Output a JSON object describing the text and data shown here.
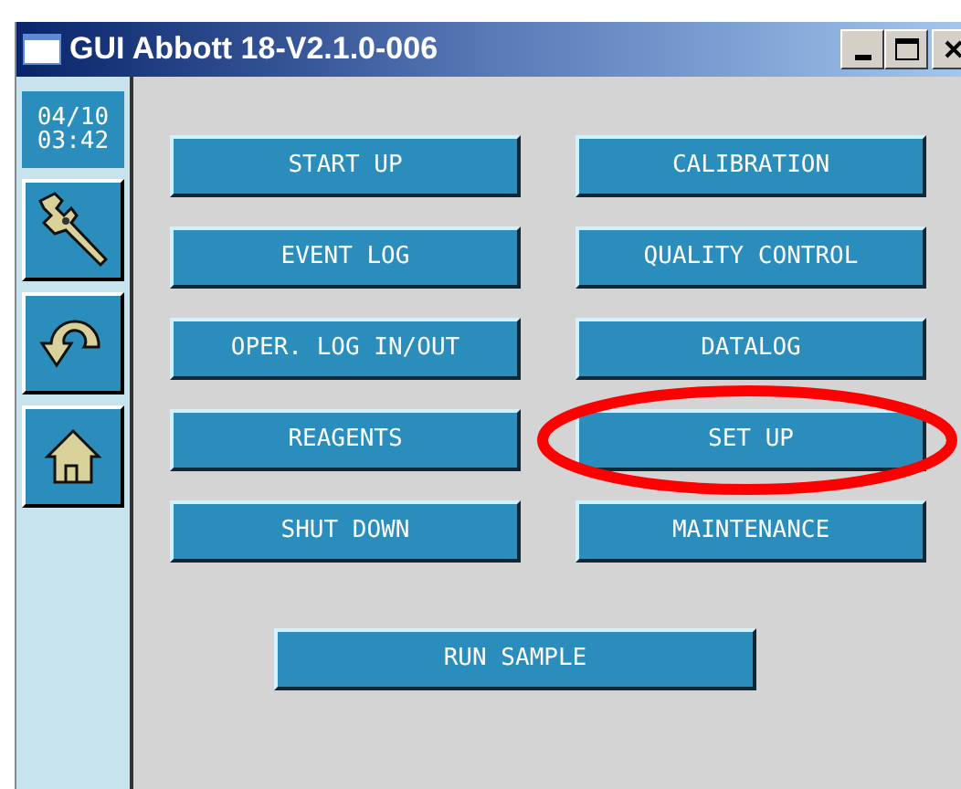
{
  "window": {
    "title": "GUI Abbott 18-V2.1.0-006"
  },
  "sidebar": {
    "date": "04/10",
    "time": "03:42",
    "tools": [
      {
        "kind": "wrench"
      },
      {
        "kind": "undo"
      },
      {
        "kind": "home"
      }
    ]
  },
  "buttons": [
    {
      "label": "START UP",
      "circled": false
    },
    {
      "label": "CALIBRATION",
      "circled": false
    },
    {
      "label": "EVENT LOG",
      "circled": false
    },
    {
      "label": "QUALITY CONTROL",
      "circled": false
    },
    {
      "label": "OPER. LOG IN/OUT",
      "circled": false
    },
    {
      "label": "DATALOG",
      "circled": false
    },
    {
      "label": "REAGENTS",
      "circled": false
    },
    {
      "label": "SET UP",
      "circled": true
    },
    {
      "label": "SHUT DOWN",
      "circled": false
    },
    {
      "label": "MAINTENANCE",
      "circled": false
    }
  ],
  "run_button": {
    "label": "RUN SAMPLE",
    "circled": false
  }
}
